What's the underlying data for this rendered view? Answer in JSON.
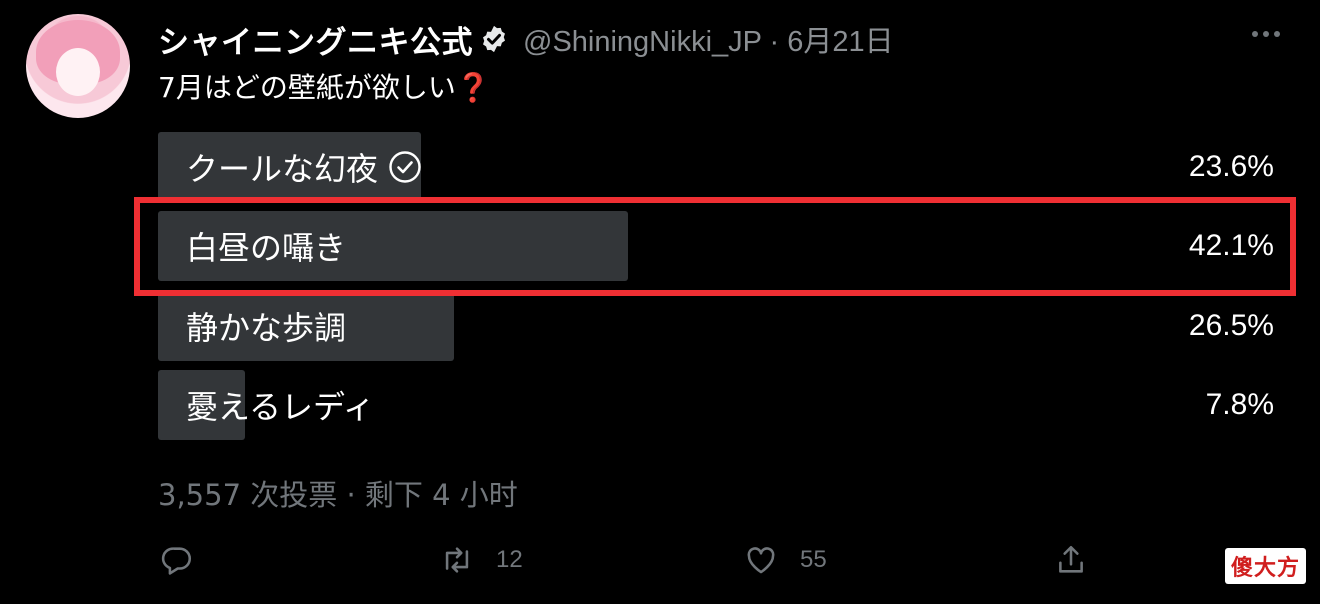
{
  "tweet": {
    "author": {
      "display_name": "シャイニングニキ公式",
      "handle_date": "@ShiningNikki_JP · 6月21日",
      "avatar_icon": "avatar",
      "verified_icon": "verified-badge-icon"
    },
    "text": "7月はどの壁紙が欲しい",
    "text_emoji": "❓",
    "more_icon": "more-dots-icon"
  },
  "poll": {
    "options": [
      {
        "label": "クールな幻夜",
        "percent": "23.6%",
        "fill": 0.236,
        "selected": true
      },
      {
        "label": "白昼の囁き",
        "percent": "42.1%",
        "fill": 0.421,
        "selected": false,
        "highlighted": true
      },
      {
        "label": "静かな歩調",
        "percent": "26.5%",
        "fill": 0.265,
        "selected": false
      },
      {
        "label": "憂えるレディ",
        "percent": "7.8%",
        "fill": 0.078,
        "selected": false
      }
    ],
    "meta": "3,557 次投票 · 剩下 4 小时"
  },
  "actions": {
    "reply": {
      "icon": "reply-icon",
      "count": ""
    },
    "retweet": {
      "icon": "retweet-icon",
      "count": "12"
    },
    "like": {
      "icon": "heart-icon",
      "count": "55"
    },
    "share": {
      "icon": "share-icon",
      "count": ""
    }
  },
  "watermark": "傻大方",
  "colors": {
    "background": "#000000",
    "poll_fill": "#333639",
    "highlight": "#ef2f33",
    "muted": "#71767b"
  }
}
